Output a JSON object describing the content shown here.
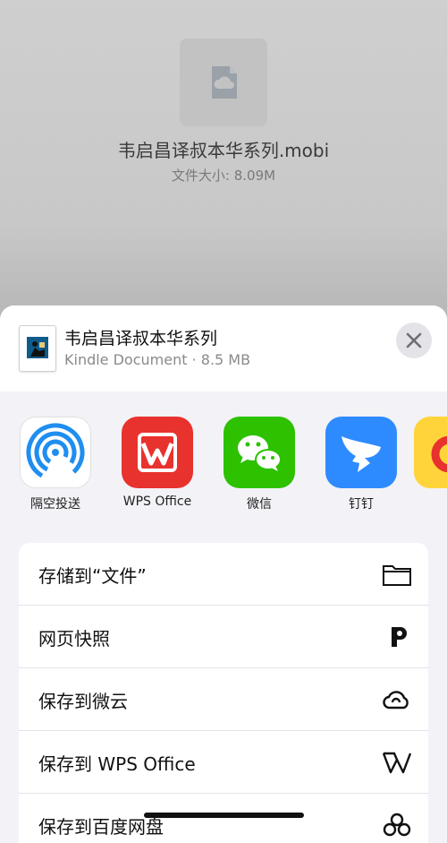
{
  "preview": {
    "file_name": "韦启昌译叔本华系列.mobi",
    "file_size": "文件大小: 8.09M"
  },
  "sheet": {
    "title": "韦启昌译叔本华系列",
    "subtitle": "Kindle Document · 8.5 MB"
  },
  "apps": [
    {
      "label": "隔空投送",
      "icon": "airdrop-icon"
    },
    {
      "label": "WPS Office",
      "icon": "wps-icon"
    },
    {
      "label": "微信",
      "icon": "wechat-icon"
    },
    {
      "label": "钉钉",
      "icon": "dingtalk-icon"
    },
    {
      "label": "",
      "icon": "partial-app-icon"
    }
  ],
  "actions": [
    {
      "label": "存储到“文件”",
      "icon": "folder-icon"
    },
    {
      "label": "网页快照",
      "icon": "p-icon"
    },
    {
      "label": "保存到微云",
      "icon": "cloud-icon"
    },
    {
      "label": "保存到 WPS Office",
      "icon": "wps-w-icon"
    },
    {
      "label": "保存到百度网盘",
      "icon": "baidu-icon"
    }
  ],
  "colors": {
    "wps_red": "#E8322E",
    "wechat_green": "#2DC100",
    "dingtalk_blue": "#2E8BFF",
    "airdrop_blue": "#1F8EF1"
  }
}
